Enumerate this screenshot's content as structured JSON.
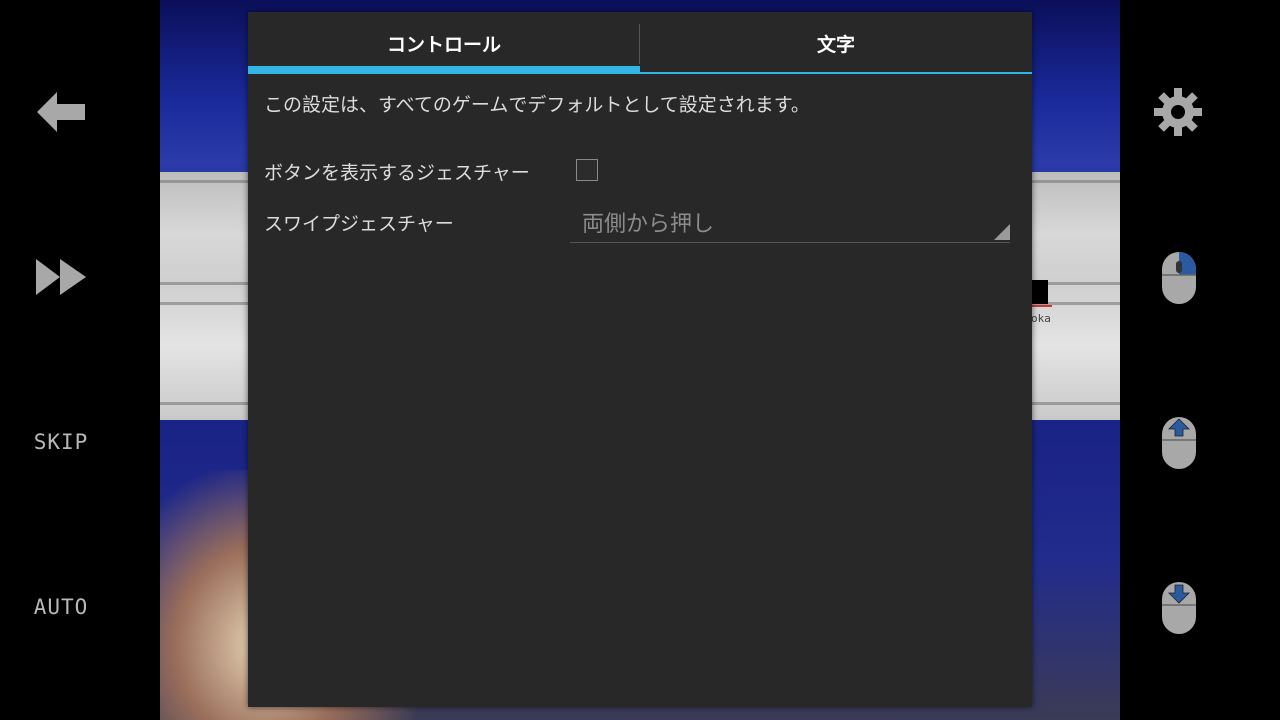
{
  "left_controls": {
    "skip_label": "SKIP",
    "auto_label": "AUTO"
  },
  "game_scene": {
    "name_fragment": "oka"
  },
  "dialog": {
    "tabs": [
      {
        "label": "コントロール",
        "active": true
      },
      {
        "label": "文字",
        "active": false
      }
    ],
    "description": "この設定は、すべてのゲームでデフォルトとして設定されます。",
    "gesture_show_buttons": {
      "label": "ボタンを表示するジェスチャー",
      "checked": false
    },
    "swipe_gesture": {
      "label": "スワイプジェスチャー",
      "value": "両側から押し"
    }
  },
  "colors": {
    "accent": "#33b5e5",
    "dialog_bg": "#282828",
    "text": "#dcdcdc"
  }
}
